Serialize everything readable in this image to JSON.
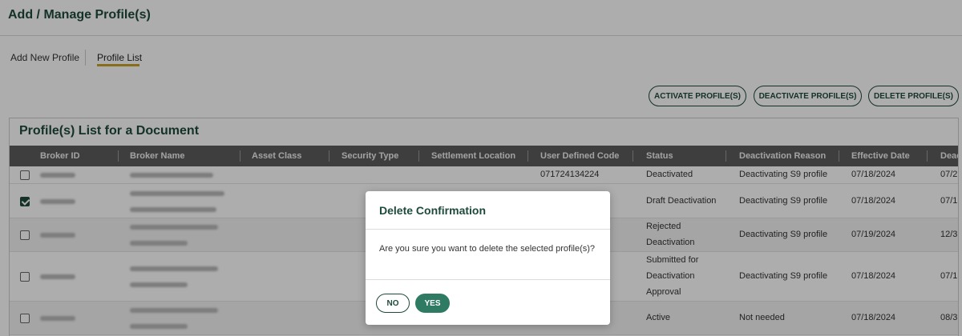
{
  "page": {
    "title": "Add / Manage Profile(s)"
  },
  "tabs": [
    {
      "label": "Add New Profile"
    },
    {
      "label": "Profile List"
    }
  ],
  "actions": {
    "activate": "ACTIVATE PROFILE(S)",
    "deactivate": "DEACTIVATE PROFILE(S)",
    "delete": "DELETE PROFILE(S)"
  },
  "panel": {
    "title": "Profile(s) List for a Document"
  },
  "table": {
    "columns": [
      "Broker ID",
      "Broker Name",
      "Asset Class",
      "Security Type",
      "Settlement Location",
      "User Defined Code",
      "Status",
      "Deactivation Reason",
      "Effective Date",
      "Deac"
    ],
    "rows": [
      {
        "checked": false,
        "user_code": "071724134224",
        "status": [
          "Deactivated"
        ],
        "reason": "Deactivating S9 profile",
        "effective": "07/18/2024",
        "deac": "07/2"
      },
      {
        "checked": true,
        "user_code": "",
        "status": [
          "Draft Deactivation"
        ],
        "reason": "Deactivating S9 profile",
        "effective": "07/18/2024",
        "deac": "07/1"
      },
      {
        "checked": false,
        "user_code": "",
        "status": [
          "Rejected",
          "Deactivation"
        ],
        "reason": "Deactivating S9 profile",
        "effective": "07/19/2024",
        "deac": "12/3"
      },
      {
        "checked": false,
        "user_code": "",
        "status": [
          "Submitted for",
          "Deactivation",
          "Approval"
        ],
        "reason": "Deactivating S9 profile",
        "effective": "07/18/2024",
        "deac": "07/1"
      },
      {
        "checked": false,
        "user_code": "",
        "status": [
          "Active"
        ],
        "reason": "Not needed",
        "effective": "07/18/2024",
        "deac": "08/3"
      }
    ]
  },
  "modal": {
    "title": "Delete Confirmation",
    "message": "Are you sure you want to delete the selected profile(s)?",
    "no_label": "NO",
    "yes_label": "YES"
  },
  "colors": {
    "brand": "#1e4a3b",
    "accent_underline": "#c9a227",
    "yes_button": "#2e7a63",
    "header_bg": "#5c5c5c"
  }
}
